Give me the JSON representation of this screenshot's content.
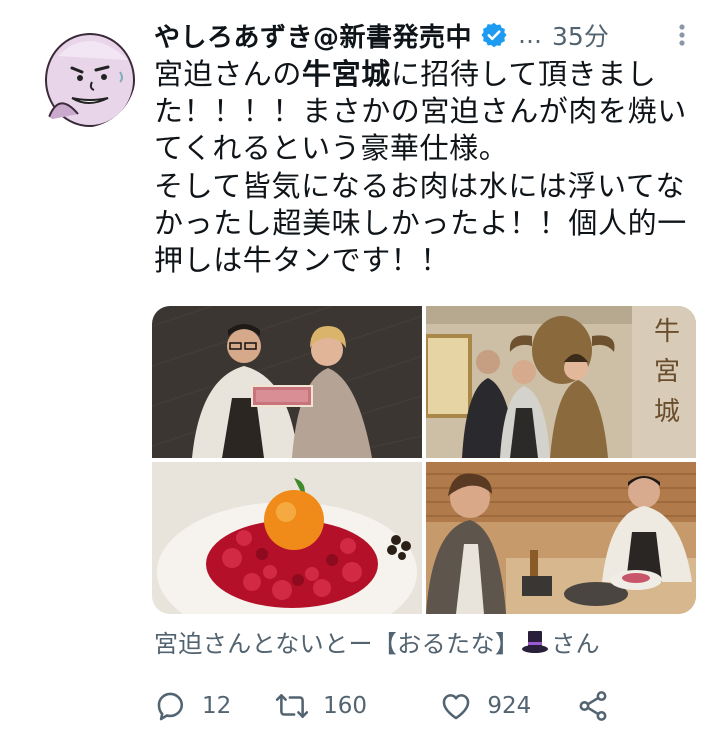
{
  "tweet": {
    "display_name": "やしろあずき@新書発売中",
    "handle": "…",
    "time": "35分",
    "text_lines": [
      {
        "prefix": "宮迫さんの",
        "bold": "牛宮城",
        "suffix": "に招待して頂きまし"
      },
      "た！！！！まさかの宮迫さんが肉を焼い",
      "てくれるという豪華仕様。",
      "そして皆気になるお肉は水には浮いてな",
      "かったし超美味しかったよ！！個人的一",
      "押しは牛タンです！！"
    ],
    "quote_before": "宮迫さんとないとー【おるたな】",
    "quote_after": "さん",
    "stats": {
      "replies": "12",
      "retweets": "160",
      "likes": "924"
    }
  },
  "icons": {
    "verified": "verified-badge-icon",
    "more": "more-vertical-icon",
    "reply": "reply-bubble-icon",
    "retweet": "retweet-icon",
    "like": "heart-icon",
    "share": "share-icon",
    "hat": "top-hat-emoji"
  },
  "colors": {
    "accent": "#1d9bf0",
    "muted": "#536471",
    "text": "#0f1419"
  }
}
